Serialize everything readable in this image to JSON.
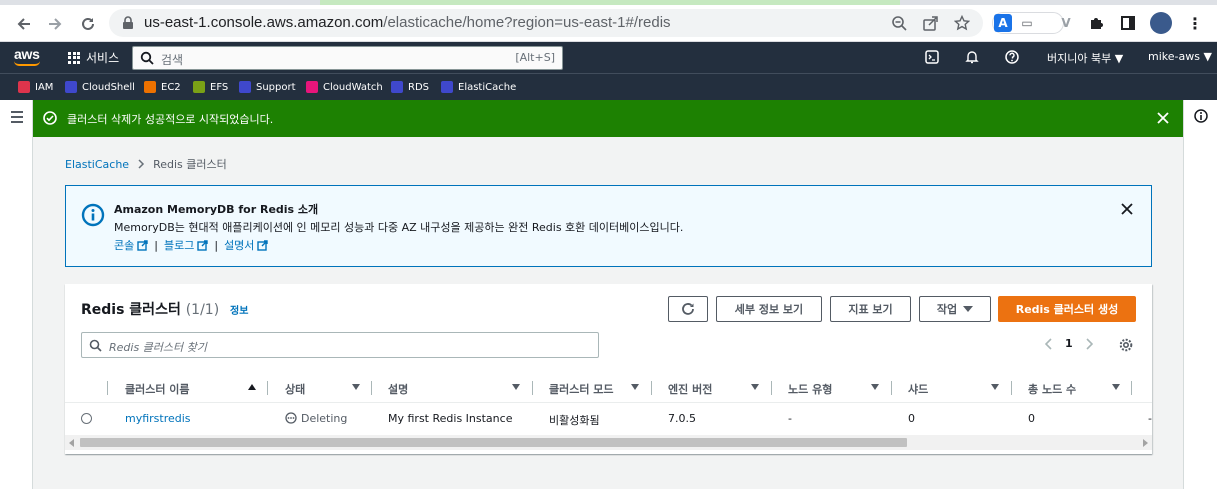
{
  "browser": {
    "url_host": "us-east-1.console.aws.amazon.com",
    "url_path": "/elasticache/home?region=us-east-1#/redis"
  },
  "aws_header": {
    "logo": "aws",
    "services_label": "서비스",
    "search_placeholder": "검색",
    "search_shortcut": "[Alt+S]",
    "region_label": "버지니아 북부",
    "account_label": "mike-aws"
  },
  "favorites": [
    {
      "label": "IAM",
      "color": "#dd344c"
    },
    {
      "label": "CloudShell",
      "color": "#3f48cc"
    },
    {
      "label": "EC2",
      "color": "#ed7100"
    },
    {
      "label": "EFS",
      "color": "#7aa116"
    },
    {
      "label": "Support",
      "color": "#3f48cc"
    },
    {
      "label": "CloudWatch",
      "color": "#e7157b"
    },
    {
      "label": "RDS",
      "color": "#3f48cc"
    },
    {
      "label": "ElastiCache",
      "color": "#3f48cc"
    }
  ],
  "flash": {
    "message": "클러스터 삭제가 성공적으로 시작되었습니다.",
    "color": "#1d8102"
  },
  "breadcrumb": {
    "parent": "ElastiCache",
    "current": "Redis 클러스터"
  },
  "info_alert": {
    "title": "Amazon MemoryDB for Redis 소개",
    "description": "MemoryDB는 현대적 애플리케이션에 인 메모리 성능과 다중 AZ 내구성을 제공하는 완전 Redis 호환 데이터베이스입니다.",
    "links": [
      "콘솔",
      "블로그",
      "설명서"
    ],
    "separator": "|"
  },
  "panel": {
    "title": "Redis 클러스터",
    "count": "(1/1)",
    "info_link": "정보",
    "buttons": {
      "details": "세부 정보 보기",
      "metrics": "지표 보기",
      "actions": "작업",
      "create": "Redis 클러스터 생성"
    },
    "filter_placeholder": "Redis 클러스터 찾기",
    "page": "1",
    "columns": [
      "클러스터 이름",
      "상태",
      "설명",
      "클러스터 모드",
      "엔진 버전",
      "노드 유형",
      "샤드",
      "총 노드 수"
    ],
    "rows": [
      {
        "name": "myfirstredis",
        "status": "Deleting",
        "description": "My first Redis Instance",
        "cluster_mode": "비활성화됨",
        "engine_version": "7.0.5",
        "node_type": "-",
        "shards": "0",
        "total_nodes": "0",
        "overflow": "-"
      }
    ]
  },
  "colors": {
    "primary": "#ec7211",
    "link": "#0073bb",
    "aws_nav": "#232f3e"
  }
}
